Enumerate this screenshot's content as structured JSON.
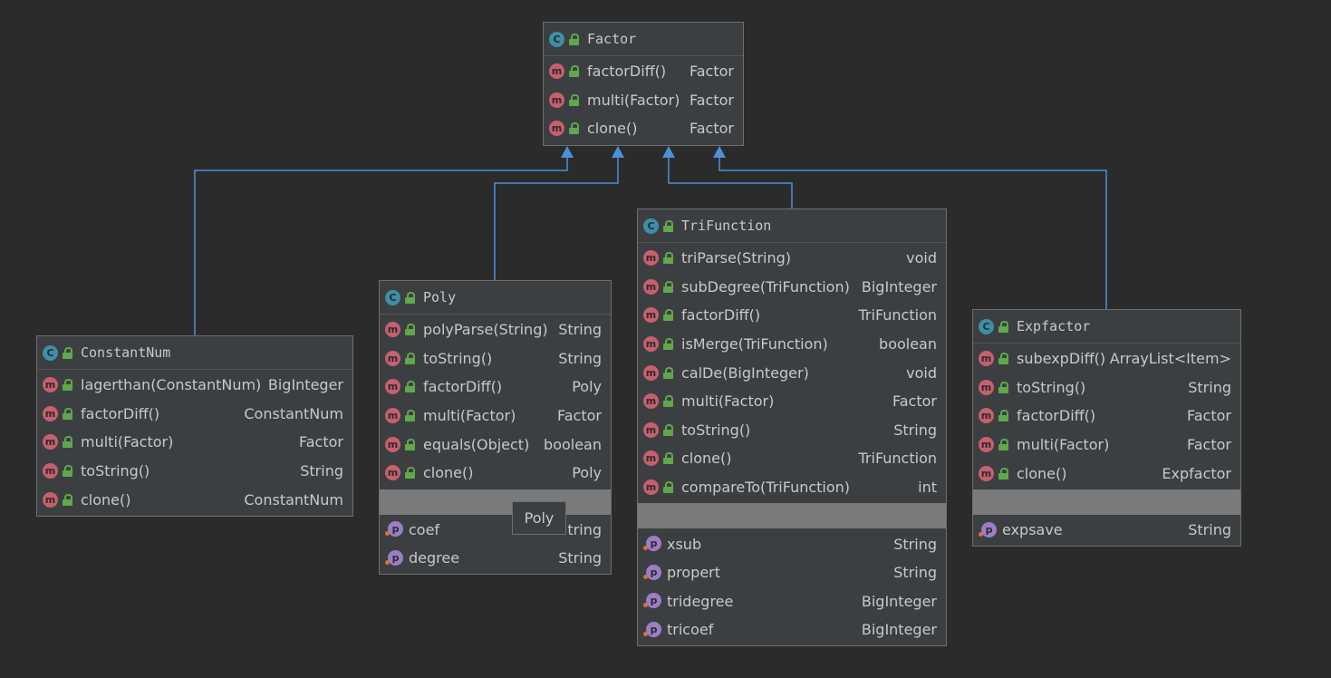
{
  "colors": {
    "background": "#2b2b2b",
    "node_fill": "#3c3f41",
    "edge": "#4e8fd6",
    "class_badge": "#3d8fa5",
    "method_badge": "#c75f6e",
    "property_badge": "#9c7ec4",
    "public_lock": "#5fa84b"
  },
  "icons": {
    "class": "C",
    "method": "m",
    "property": "p"
  },
  "classes": [
    {
      "id": "factor",
      "name": "Factor",
      "methods": [
        {
          "name": "factorDiff()",
          "type": "Factor"
        },
        {
          "name": "multi(Factor)",
          "type": "Factor"
        },
        {
          "name": "clone()",
          "type": "Factor"
        }
      ],
      "properties": []
    },
    {
      "id": "constantnum",
      "name": "ConstantNum",
      "methods": [
        {
          "name": "lagerthan(ConstantNum)",
          "type": "BigInteger"
        },
        {
          "name": "factorDiff()",
          "type": "ConstantNum"
        },
        {
          "name": "multi(Factor)",
          "type": "Factor"
        },
        {
          "name": "toString()",
          "type": "String"
        },
        {
          "name": "clone()",
          "type": "ConstantNum"
        }
      ],
      "properties": []
    },
    {
      "id": "poly",
      "name": "Poly",
      "methods": [
        {
          "name": "polyParse(String)",
          "type": "String"
        },
        {
          "name": "toString()",
          "type": "String"
        },
        {
          "name": "factorDiff()",
          "type": "Poly"
        },
        {
          "name": "multi(Factor)",
          "type": "Factor"
        },
        {
          "name": "equals(Object)",
          "type": "boolean"
        },
        {
          "name": "clone()",
          "type": "Poly"
        }
      ],
      "properties": [
        {
          "name": "coef",
          "type": "tring"
        },
        {
          "name": "degree",
          "type": "String"
        }
      ]
    },
    {
      "id": "trifunction",
      "name": "TriFunction",
      "methods": [
        {
          "name": "triParse(String)",
          "type": "void"
        },
        {
          "name": "subDegree(TriFunction)",
          "type": "BigInteger"
        },
        {
          "name": "factorDiff()",
          "type": "TriFunction"
        },
        {
          "name": "isMerge(TriFunction)",
          "type": "boolean"
        },
        {
          "name": "calDe(BigInteger)",
          "type": "void"
        },
        {
          "name": "multi(Factor)",
          "type": "Factor"
        },
        {
          "name": "toString()",
          "type": "String"
        },
        {
          "name": "clone()",
          "type": "TriFunction"
        },
        {
          "name": "compareTo(TriFunction)",
          "type": "int"
        }
      ],
      "properties": [
        {
          "name": "xsub",
          "type": "String"
        },
        {
          "name": "propert",
          "type": "String"
        },
        {
          "name": "tridegree",
          "type": "BigInteger"
        },
        {
          "name": "tricoef",
          "type": "BigInteger"
        }
      ]
    },
    {
      "id": "expfactor",
      "name": "Expfactor",
      "methods": [
        {
          "name": "subexpDiff()",
          "type": "ArrayList<Item>"
        },
        {
          "name": "toString()",
          "type": "String"
        },
        {
          "name": "factorDiff()",
          "type": "Factor"
        },
        {
          "name": "multi(Factor)",
          "type": "Factor"
        },
        {
          "name": "clone()",
          "type": "Expfactor"
        }
      ],
      "properties": [
        {
          "name": "expsave",
          "type": "String"
        }
      ]
    }
  ],
  "edges": [
    {
      "from": "constantnum",
      "to": "factor",
      "kind": "extends"
    },
    {
      "from": "poly",
      "to": "factor",
      "kind": "extends"
    },
    {
      "from": "trifunction",
      "to": "factor",
      "kind": "extends"
    },
    {
      "from": "expfactor",
      "to": "factor",
      "kind": "extends"
    }
  ],
  "tooltip": {
    "text": "Poly"
  }
}
